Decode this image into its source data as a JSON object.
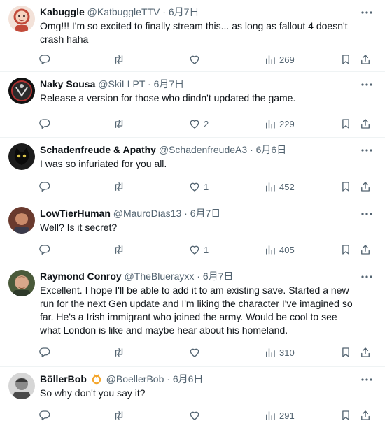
{
  "icons": {
    "more": "more-horizontal-icon",
    "reply": "reply-icon",
    "retweet": "retweet-icon",
    "like": "heart-icon",
    "views": "views-chart-icon",
    "bookmark": "bookmark-icon",
    "share": "share-icon",
    "badge": "verified-ring-badge-icon"
  },
  "colors": {
    "text": "#0f1419",
    "secondary": "#536471",
    "divider": "#eff3f4",
    "badge": "#f4a52a"
  },
  "tweets": [
    {
      "name": "Kabuggle",
      "handle": "@KatbuggleTTV",
      "separator": "·",
      "date": "6月7日",
      "text": "Omg!!! I'm so excited to finally stream this... as long as fallout 4 doesn't crash haha",
      "likes": "",
      "views": "269",
      "has_badge": false
    },
    {
      "name": "Naky Sousa",
      "handle": "@SkiLLPT",
      "separator": "·",
      "date": "6月7日",
      "text": "Release a version for those who dindn't updated the game.",
      "likes": "2",
      "views": "229",
      "has_badge": false
    },
    {
      "name": "Schadenfreude & Apathy",
      "handle": "@SchadenfreudeA3",
      "separator": "·",
      "date": "6月6日",
      "text": "I was so infuriated for you all.",
      "likes": "1",
      "views": "452",
      "has_badge": false
    },
    {
      "name": "LowTierHuman",
      "handle": "@MauroDias13",
      "separator": "·",
      "date": "6月7日",
      "text": "Well? Is it secret?",
      "likes": "1",
      "views": "405",
      "has_badge": false
    },
    {
      "name": "Raymond Conroy",
      "handle": "@TheBluerayxx",
      "separator": "·",
      "date": "6月7日",
      "text": "Excellent. I hope I'll be able to add it to am existing save. Started a new run for the next Gen update and I'm liking the character I've imagined so far. He's a Irish immigrant who joined the army. Would be cool to see what London is like and maybe hear about his homeland.",
      "likes": "",
      "views": "310",
      "has_badge": false
    },
    {
      "name": "BöllerBob",
      "handle": "@BoellerBob",
      "separator": "·",
      "date": "6月6日",
      "text": "So why don't you say it?",
      "likes": "",
      "views": "291",
      "has_badge": true
    }
  ]
}
